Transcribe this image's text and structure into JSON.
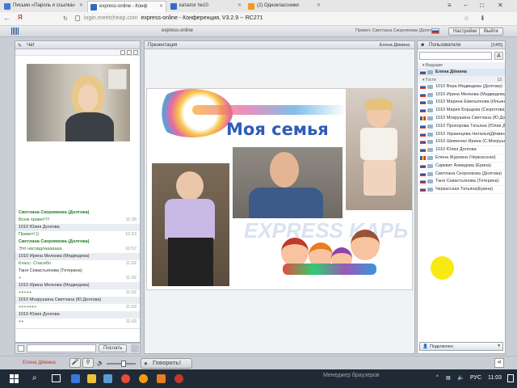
{
  "browser": {
    "tabs": [
      {
        "label": "Письмо «Пароль и ссылка»",
        "fav": "#3f7ad8"
      },
      {
        "label": "express-online - Конф",
        "fav": "#2f6db5"
      },
      {
        "label": "каталог №10",
        "fav": "#3a6bc7"
      },
      {
        "label": "(2) Одноклассники",
        "fav": "#f59a1b"
      }
    ],
    "url_domain": "login.meetcheap.com",
    "url_title": "express-online - Конференция, V3.2.9 -- RC271",
    "yandex_icon": "Я"
  },
  "app": {
    "brand": "express-online",
    "user_info": "Привет, Светлана Скорнякова (Долгова)",
    "settings_label": "Настройки",
    "exit_label": "Выйти"
  },
  "chat": {
    "title": "Чат",
    "messages": [
      {
        "name": "Светлана Скорнякова (Долгова)",
        "style": "green",
        "text": "Всем привет!!!!",
        "time": "11:28"
      },
      {
        "name": "1010 Юлия Долгова",
        "style": "blue",
        "text": "Привет!:))",
        "time": "10:53"
      },
      {
        "name": "Светлана Скорнякова (Долгова)",
        "style": "green",
        "text": "Это насовдлааааааа",
        "time": "10:57"
      },
      {
        "name": "1010 Ирина Мелкова (Медведева)",
        "style": "blue",
        "text": "Класс. Спасибо",
        "time": "11:02"
      },
      {
        "name": "Таня Севастьянова (Тетерина)",
        "style": "plain",
        "text": "+",
        "time": "11:02"
      },
      {
        "name": "1010 Ирина Мелкова (Медведева)",
        "style": "blue",
        "text": "+++++",
        "time": "11:02"
      },
      {
        "name": "1010 Мокрушина Светлана (Ю.Долгова)",
        "style": "blue",
        "text": "+++++++",
        "time": "11:03"
      },
      {
        "name": "1010 Юлия Долгова",
        "style": "blue",
        "text": "++",
        "time": "11:03"
      }
    ],
    "send_label": "Послать"
  },
  "presentation": {
    "title": "Презентация",
    "presenter": "Елена Дёмина",
    "slide_title": "Моя семья",
    "watermark": "EXPRESS KAPЬ"
  },
  "users": {
    "title": "Пользователи",
    "count": "[14/5]",
    "group_leading": "Ведущие",
    "leader": "Елена Дёмина",
    "group_guests": "Гости",
    "guests_count": "13",
    "list": [
      {
        "name": "1010 Вера Медведева (Долгова)",
        "flag": "ru"
      },
      {
        "name": "1010 Ирина Мелкова (Медведева)",
        "flag": "ru"
      },
      {
        "name": "1010 Марина Емельянова (Ильина)",
        "flag": "ru"
      },
      {
        "name": "1010 Мария Борщева (Скоротова)",
        "flag": "ru"
      },
      {
        "name": "1010 Мокрушина Светлана (Ю.Долгова)",
        "flag": "ro"
      },
      {
        "name": "1010 Прохорова Татьяна (Юлия Долгова)",
        "flag": "ru"
      },
      {
        "name": "1010 Украинцева Наталья(Дёмина)",
        "flag": "ru"
      },
      {
        "name": "1010 Шевченко Ирина (С.Мокрушина)",
        "flag": "ru"
      },
      {
        "name": "1010 Юлия Долгова",
        "flag": "ru"
      },
      {
        "name": "Елена Журкина (Черкасская)",
        "flag": "ro"
      },
      {
        "name": "Сарквит Ахмедова (Ерина)",
        "flag": "ru"
      },
      {
        "name": "Светлана Скорнякова (Долгова)",
        "flag": "ru"
      },
      {
        "name": "Таня Севастьянова (Тетерина)",
        "flag": "ru"
      },
      {
        "name": "Черкасская Татьяна(Ерина)",
        "flag": "ru"
      }
    ],
    "status_label": "Подключен"
  },
  "bottom": {
    "presenter_name": "Елена Дёмина",
    "speak_label": "Говорить!"
  },
  "taskbar": {
    "browser_manager": "Менеджер браузеров",
    "lang": "РУС",
    "time": "11:03"
  }
}
